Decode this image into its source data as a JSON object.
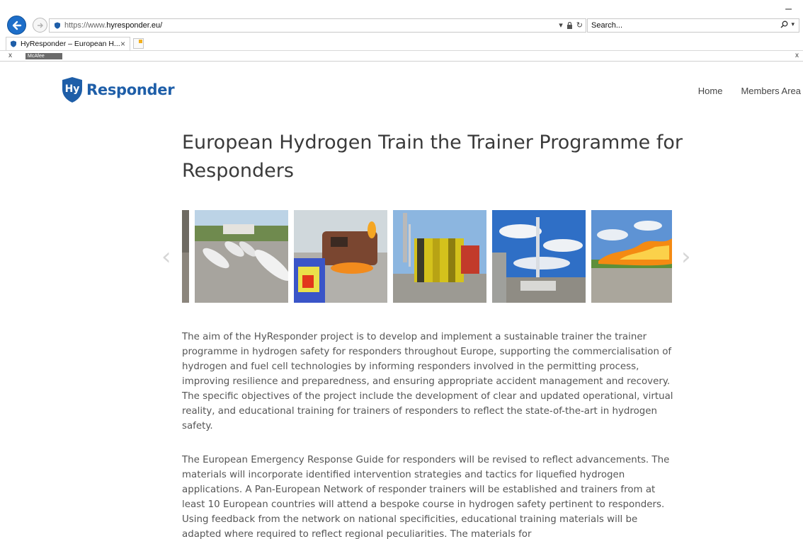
{
  "browser": {
    "url_prefix": "https://www.",
    "url_domain": "hyresponder.eu",
    "url_path": "/",
    "search_placeholder": "Search...",
    "tab_title": "HyResponder – European H...",
    "tab_close": "×",
    "toolbar_close": "x",
    "mcafee_label": "McAfee",
    "window_minimize": "–"
  },
  "site": {
    "logo_text": "Responder",
    "logo_badge": "Hy",
    "nav": [
      "Home",
      "Members Area"
    ]
  },
  "main": {
    "title": "European Hydrogen Train the Trainer Programme for Responders",
    "carousel_prev": "‹",
    "carousel_next": "›",
    "paragraphs": [
      "The aim of the HyResponder project is to develop and implement a sustainable trainer the trainer programme in hydrogen safety for responders throughout Europe, supporting the commercialisation of hydrogen and fuel cell technologies by informing responders involved in the permitting process, improving resilience and preparedness, and ensuring appropriate accident management and recovery. The specific objectives of the project include the development of clear and updated operational, virtual reality, and educational training for trainers of responders to reflect the state-of-the-art in hydrogen safety.",
      "The European Emergency Response Guide for responders will be revised to reflect advancements. The materials will incorporate identified intervention strategies and tactics for liquefied hydrogen applications. A Pan-European Network of responder trainers will be established and trainers from at least 10 European countries will attend a bespoke course in hydrogen safety pertinent to responders. Using feedback from the network on national specificities, educational training materials will be adapted where required to reflect regional peculiarities. The materials for"
    ]
  },
  "colors": {
    "brand_blue": "#1e5ea8",
    "text_gray": "#555555",
    "title_gray": "#3a3a3a"
  }
}
